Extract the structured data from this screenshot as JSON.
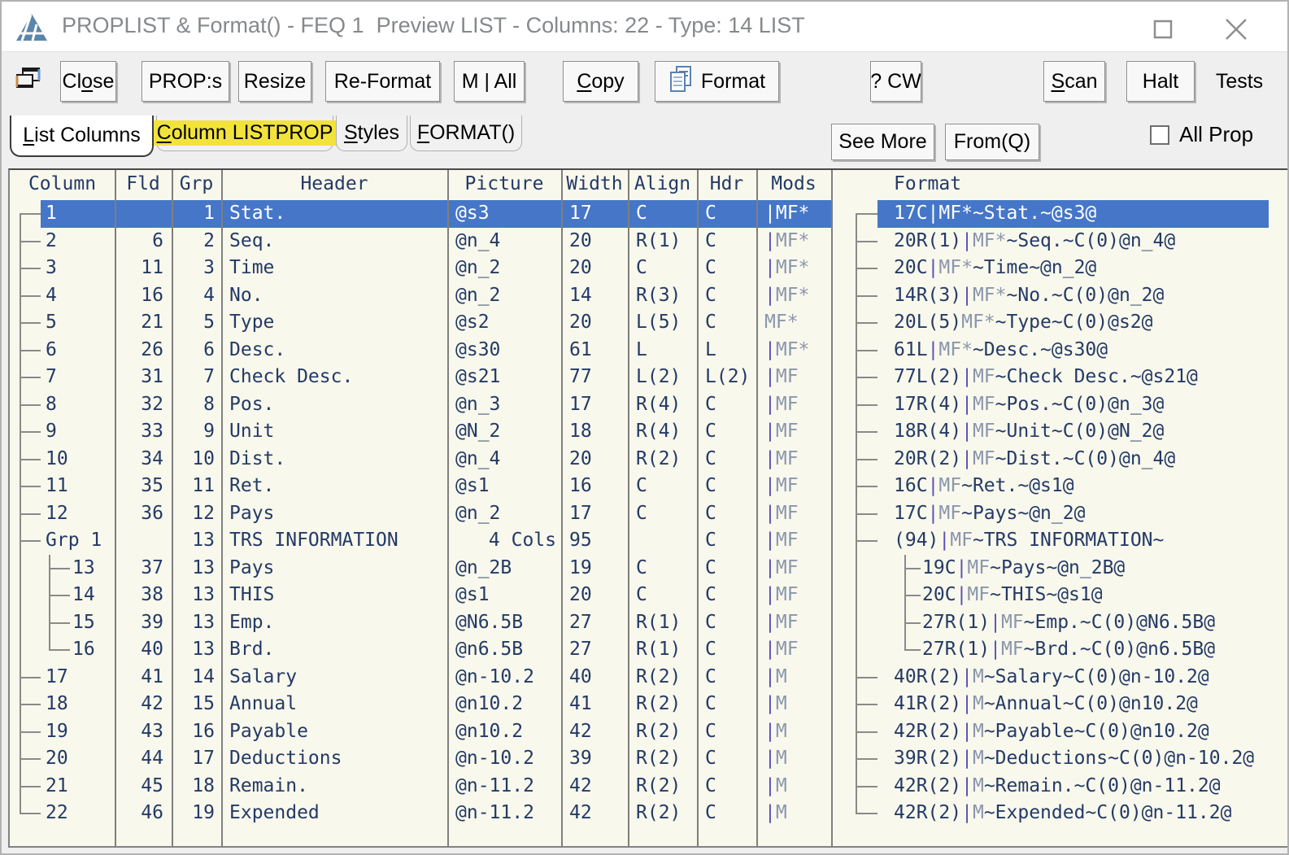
{
  "window": {
    "title": "PROPLIST & Format() - FEQ 1  Preview LIST - Columns: 22 - Type: 14 LIST",
    "controls": {
      "maximize": "maximize",
      "close": "close"
    }
  },
  "toolbar": {
    "buttons": [
      {
        "id": "cascade",
        "label": "",
        "icon": "cascade-windows-icon"
      },
      {
        "id": "close",
        "label": "Close",
        "accel": 2
      },
      {
        "id": "props",
        "label": "PROP:s"
      },
      {
        "id": "resize",
        "label": "Resize"
      },
      {
        "id": "reformat",
        "label": "Re-Format"
      },
      {
        "id": "mall",
        "label": "M | All"
      },
      {
        "id": "copy",
        "label": "Copy",
        "accel": 0
      },
      {
        "id": "format",
        "label": "Format",
        "icon": "document-copy-icon"
      },
      {
        "id": "qcw",
        "label": "? CW"
      },
      {
        "id": "scan",
        "label": "Scan",
        "accel": 0
      },
      {
        "id": "halt",
        "label": "Halt"
      },
      {
        "id": "tests",
        "label": "Tests",
        "flat": true
      }
    ]
  },
  "tabs": {
    "items": [
      {
        "label": "List Columns",
        "accel": 0,
        "active": true
      },
      {
        "label": "Column LISTPROP",
        "accel": 0,
        "highlighted": true
      },
      {
        "label": "Styles",
        "accel": 0
      },
      {
        "label": "FORMAT()",
        "accel": 0
      }
    ],
    "right_buttons": [
      {
        "id": "see_more",
        "label": "See More"
      },
      {
        "id": "fromq",
        "label": "From(Q)"
      }
    ],
    "all_prop": {
      "label": "All Prop",
      "checked": false
    }
  },
  "table": {
    "headers": [
      "Column",
      "Fld",
      "Grp",
      "Header",
      "Picture",
      "Width",
      "Align",
      "Hdr",
      "Mods",
      "Format"
    ],
    "rows": [
      {
        "column": "1",
        "fld": "",
        "grp": "1",
        "header": "Stat.",
        "picture": "@s3",
        "width": "17",
        "align": "C",
        "hdr": "C",
        "mods": "|MF*",
        "format": "17C|MF*~Stat.~@s3@",
        "level": 0,
        "selected": true
      },
      {
        "column": "2",
        "fld": "6",
        "grp": "2",
        "header": "Seq.",
        "picture": "@n_4",
        "width": "20",
        "align": "R(1)",
        "hdr": "C",
        "mods": "|MF*",
        "format": "20R(1)|MF*~Seq.~C(0)@n_4@",
        "level": 0
      },
      {
        "column": "3",
        "fld": "11",
        "grp": "3",
        "header": "Time",
        "picture": "@n_2",
        "width": "20",
        "align": "C",
        "hdr": "C",
        "mods": "|MF*",
        "format": "20C|MF*~Time~@n_2@",
        "level": 0
      },
      {
        "column": "4",
        "fld": "16",
        "grp": "4",
        "header": "No.",
        "picture": "@n_2",
        "width": "14",
        "align": "R(3)",
        "hdr": "C",
        "mods": "|MF*",
        "format": "14R(3)|MF*~No.~C(0)@n_2@",
        "level": 0
      },
      {
        "column": "5",
        "fld": "21",
        "grp": "5",
        "header": "Type",
        "picture": "@s2",
        "width": "20",
        "align": "L(5)",
        "hdr": "C",
        "mods": "MF*",
        "format": "20L(5)MF*~Type~C(0)@s2@",
        "level": 0
      },
      {
        "column": "6",
        "fld": "26",
        "grp": "6",
        "header": "Desc.",
        "picture": "@s30",
        "width": "61",
        "align": "L",
        "hdr": "L",
        "mods": "|MF*",
        "format": "61L|MF*~Desc.~@s30@",
        "level": 0
      },
      {
        "column": "7",
        "fld": "31",
        "grp": "7",
        "header": "Check Desc.",
        "picture": "@s21",
        "width": "77",
        "align": "L(2)",
        "hdr": "L(2)",
        "mods": "|MF",
        "format": "77L(2)|MF~Check Desc.~@s21@",
        "level": 0
      },
      {
        "column": "8",
        "fld": "32",
        "grp": "8",
        "header": "Pos.",
        "picture": "@n_3",
        "width": "17",
        "align": "R(4)",
        "hdr": "C",
        "mods": "|MF",
        "format": "17R(4)|MF~Pos.~C(0)@n_3@",
        "level": 0
      },
      {
        "column": "9",
        "fld": "33",
        "grp": "9",
        "header": "Unit",
        "picture": "@N_2",
        "width": "18",
        "align": "R(4)",
        "hdr": "C",
        "mods": "|MF",
        "format": "18R(4)|MF~Unit~C(0)@N_2@",
        "level": 0
      },
      {
        "column": "10",
        "fld": "34",
        "grp": "10",
        "header": "Dist.",
        "picture": "@n_4",
        "width": "20",
        "align": "R(2)",
        "hdr": "C",
        "mods": "|MF",
        "format": "20R(2)|MF~Dist.~C(0)@n_4@",
        "level": 0
      },
      {
        "column": "11",
        "fld": "35",
        "grp": "11",
        "header": "Ret.",
        "picture": "@s1",
        "width": "16",
        "align": "C",
        "hdr": "C",
        "mods": "|MF",
        "format": "16C|MF~Ret.~@s1@",
        "level": 0
      },
      {
        "column": "12",
        "fld": "36",
        "grp": "12",
        "header": "Pays",
        "picture": "@n_2",
        "width": "17",
        "align": "C",
        "hdr": "C",
        "mods": "|MF",
        "format": "17C|MF~Pays~@n_2@",
        "level": 0
      },
      {
        "column": "Grp 1",
        "fld": "",
        "grp": "13",
        "header": "TRS INFORMATION",
        "picture": "4 Cols",
        "width": "95",
        "align": "",
        "hdr": "C",
        "mods": "|MF",
        "format": "(94)|MF~TRS INFORMATION~",
        "level": 0,
        "group": true
      },
      {
        "column": "13",
        "fld": "37",
        "grp": "13",
        "header": "Pays",
        "picture": "@n_2B",
        "width": "19",
        "align": "C",
        "hdr": "C",
        "mods": "|MF",
        "format": "19C|MF~Pays~@n_2B@",
        "level": 1
      },
      {
        "column": "14",
        "fld": "38",
        "grp": "13",
        "header": "THIS",
        "picture": "@s1",
        "width": "20",
        "align": "C",
        "hdr": "C",
        "mods": "|MF",
        "format": "20C|MF~THIS~@s1@",
        "level": 1
      },
      {
        "column": "15",
        "fld": "39",
        "grp": "13",
        "header": "Emp.",
        "picture": "@N6.5B",
        "width": "27",
        "align": "R(1)",
        "hdr": "C",
        "mods": "|MF",
        "format": "27R(1)|MF~Emp.~C(0)@N6.5B@",
        "level": 1
      },
      {
        "column": "16",
        "fld": "40",
        "grp": "13",
        "header": "Brd.",
        "picture": "@n6.5B",
        "width": "27",
        "align": "R(1)",
        "hdr": "C",
        "mods": "|MF",
        "format": "27R(1)|MF~Brd.~C(0)@n6.5B@",
        "level": 1
      },
      {
        "column": "17",
        "fld": "41",
        "grp": "14",
        "header": "Salary",
        "picture": "@n-10.2",
        "width": "40",
        "align": "R(2)",
        "hdr": "C",
        "mods": "|M",
        "format": "40R(2)|M~Salary~C(0)@n-10.2@",
        "level": 0
      },
      {
        "column": "18",
        "fld": "42",
        "grp": "15",
        "header": "Annual",
        "picture": "@n10.2",
        "width": "41",
        "align": "R(2)",
        "hdr": "C",
        "mods": "|M",
        "format": "41R(2)|M~Annual~C(0)@n10.2@",
        "level": 0
      },
      {
        "column": "19",
        "fld": "43",
        "grp": "16",
        "header": "Payable",
        "picture": "@n10.2",
        "width": "42",
        "align": "R(2)",
        "hdr": "C",
        "mods": "|M",
        "format": "42R(2)|M~Payable~C(0)@n10.2@",
        "level": 0
      },
      {
        "column": "20",
        "fld": "44",
        "grp": "17",
        "header": "Deductions",
        "picture": "@n-10.2",
        "width": "39",
        "align": "R(2)",
        "hdr": "C",
        "mods": "|M",
        "format": "39R(2)|M~Deductions~C(0)@n-10.2@",
        "level": 0
      },
      {
        "column": "21",
        "fld": "45",
        "grp": "18",
        "header": "Remain.",
        "picture": "@n-11.2",
        "width": "42",
        "align": "R(2)",
        "hdr": "C",
        "mods": "|M",
        "format": "42R(2)|M~Remain.~C(0)@n-11.2@",
        "level": 0
      },
      {
        "column": "22",
        "fld": "46",
        "grp": "19",
        "header": "Expended",
        "picture": "@n-11.2",
        "width": "42",
        "align": "R(2)",
        "hdr": "C",
        "mods": "|M",
        "format": "42R(2)|M~Expended~C(0)@n-11.2@",
        "level": 0
      }
    ]
  },
  "colors": {
    "selection_blue": "#4576c8",
    "table_background": "#f8f8ec",
    "text_navy": "#243a66",
    "mods_gray": "#8b96ad",
    "pipe_purple": "#5a50b5",
    "highlight_yellow": "#f2e33c",
    "tree_line_gray": "#8a8a8a"
  }
}
